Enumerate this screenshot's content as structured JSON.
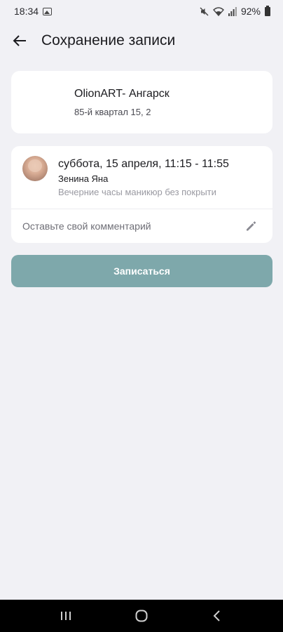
{
  "status_bar": {
    "time": "18:34",
    "battery": "92%",
    "icons": [
      "image-icon",
      "mute-icon",
      "wifi-icon",
      "signal-icon",
      "battery-icon"
    ]
  },
  "header": {
    "title": "Сохранение записи",
    "back_icon": "arrow-left-icon"
  },
  "salon": {
    "name": "OlionART- Ангарск",
    "address": "85-й квартал 15, 2"
  },
  "booking": {
    "datetime": "суббота, 15 апреля, 11:15 - 11:55",
    "master": "Зенина Яна",
    "service": "Вечерние часы маникюр без покрыти",
    "comment_placeholder": "Оставьте свой комментарий",
    "edit_icon": "pencil-icon"
  },
  "actions": {
    "submit_label": "Записаться"
  },
  "colors": {
    "background": "#f1f1f5",
    "card": "#ffffff",
    "primary_button": "#7ea8ab",
    "nav_bar": "#000000"
  },
  "nav_bar": {
    "icons": [
      "recent-apps-icon",
      "home-icon",
      "back-icon"
    ]
  }
}
